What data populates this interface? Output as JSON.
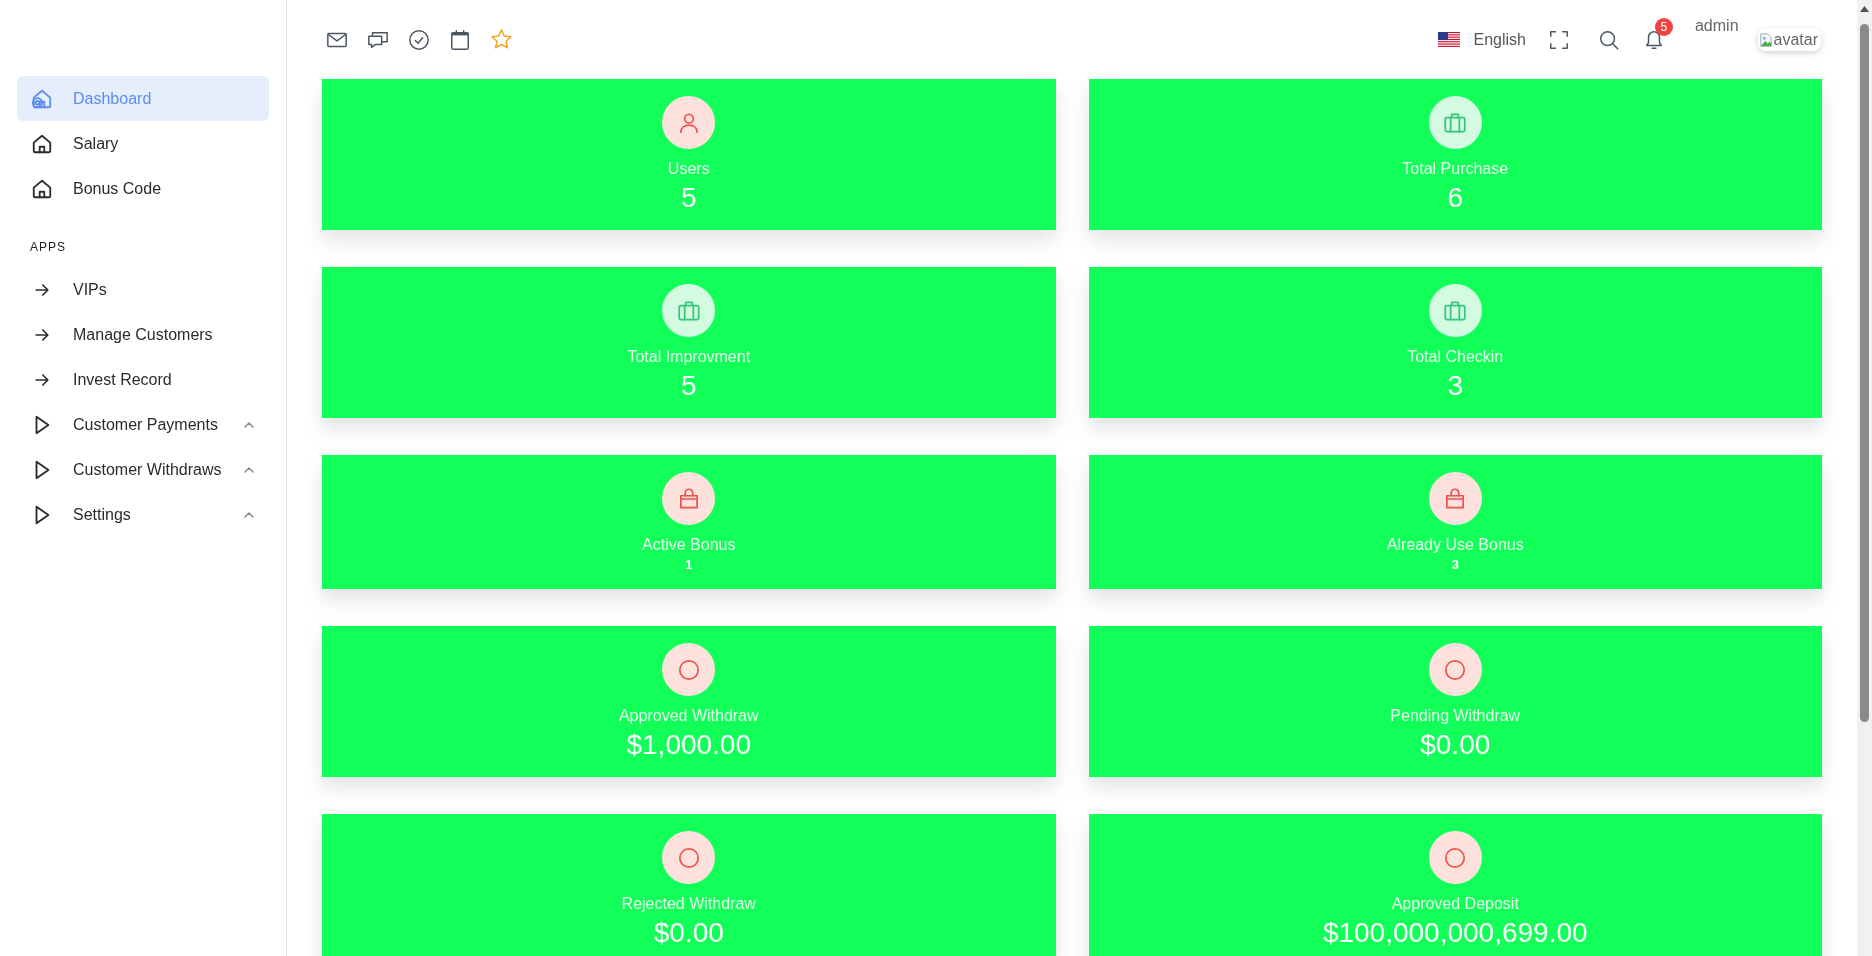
{
  "sidebar": {
    "items": [
      {
        "label": "Dashboard",
        "kind": "home",
        "selected": true
      },
      {
        "label": "Salary",
        "kind": "home",
        "selected": false
      },
      {
        "label": "Bonus Code",
        "kind": "home",
        "selected": false
      }
    ],
    "sections": [
      {
        "heading": "APPS",
        "items": [
          {
            "label": "VIPs",
            "kind": "link",
            "selected": false
          },
          {
            "label": "Manage Customers",
            "kind": "link",
            "selected": false
          },
          {
            "label": "Invest Record",
            "kind": "link",
            "selected": false
          },
          {
            "label": "Customer Payments",
            "kind": "group",
            "selected": false
          },
          {
            "label": "Customer Withdraws",
            "kind": "group",
            "selected": false
          },
          {
            "label": "Settings",
            "kind": "group",
            "selected": false
          }
        ]
      }
    ]
  },
  "header": {
    "language": "English",
    "notification_count": "5",
    "user_name": "admin",
    "avatar_alt": "avatar"
  },
  "cards": [
    {
      "label": "Users",
      "value": "5",
      "kind": "user"
    },
    {
      "label": "Total Purchase",
      "value": "6",
      "kind": "briefcase"
    },
    {
      "label": "Total Improvment",
      "value": "5",
      "kind": "briefcase"
    },
    {
      "label": "Total Checkin",
      "value": "3",
      "kind": "briefcase"
    },
    {
      "label": "Active Bonus",
      "value": "1",
      "kind": "bag"
    },
    {
      "label": "Already Use Bonus",
      "value": "3",
      "kind": "bag"
    },
    {
      "label": "Approved Withdraw",
      "value": "$1,000.00",
      "kind": "ring"
    },
    {
      "label": "Pending Withdraw",
      "value": "$0.00",
      "kind": "ring"
    },
    {
      "label": "Rejected Withdraw",
      "value": "$0.00",
      "kind": "ring"
    },
    {
      "label": "Approved Deposit",
      "value": "$100,000,000,699.00",
      "kind": "ring"
    }
  ]
}
